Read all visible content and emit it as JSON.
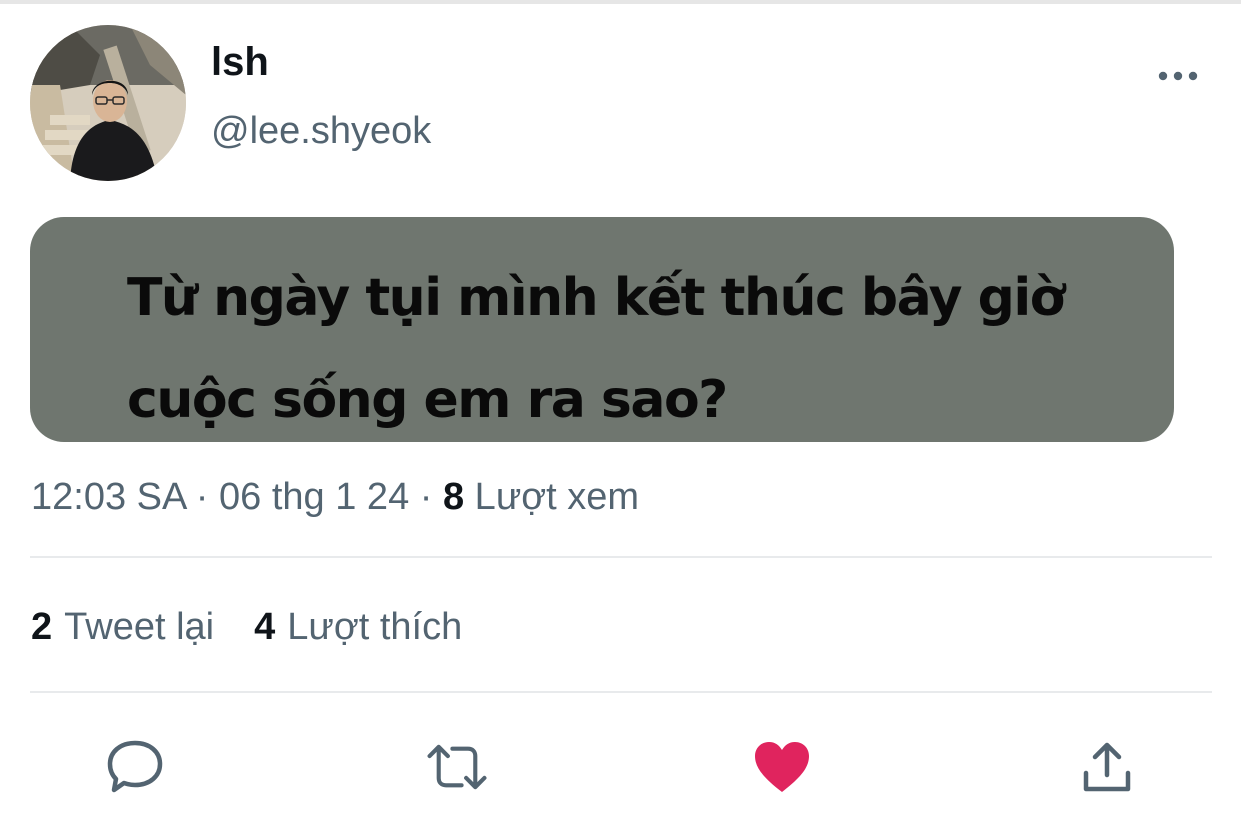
{
  "profile": {
    "display_name": "lsh",
    "handle": "@lee.shyeok"
  },
  "tweet": {
    "text_line_1": "Từ ngày tụi mình kết thúc bây giờ",
    "text_line_2": "cuộc sống em ra sao?",
    "card_color": "#6f766f"
  },
  "meta": {
    "time": "12:03 SA",
    "sep1": " · ",
    "date": "06 thg 1 24",
    "sep2": " · ",
    "views_count": "8",
    "views_label": " Lượt xem"
  },
  "stats": {
    "retweets_count": "2",
    "retweets_label": "Tweet lại",
    "likes_count": "4",
    "likes_label": "Lượt thích"
  },
  "actions": {
    "reply_icon": "speech-bubble-icon",
    "retweet_icon": "retweet-icon",
    "like_icon": "heart-icon",
    "share_icon": "share-icon",
    "like_color": "#e0245e",
    "icon_color": "#536471"
  }
}
